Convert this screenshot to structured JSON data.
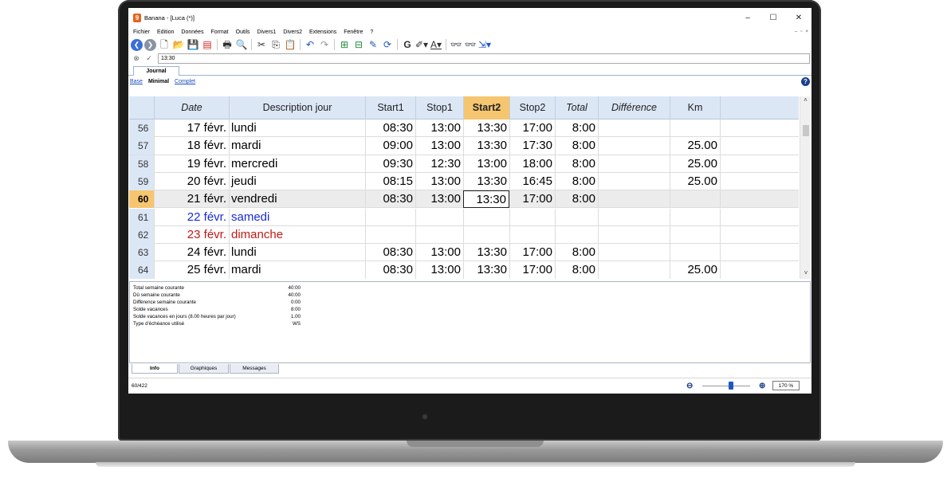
{
  "window": {
    "title": "Banana - [Luca (*)]",
    "app_icon": "9",
    "buttons": {
      "minimize": "–",
      "maximize": "☐",
      "close": "✕"
    }
  },
  "menu": [
    "Fichier",
    "Edition",
    "Données",
    "Format",
    "Outils",
    "Divers1",
    "Divers2",
    "Extensions",
    "Fenêtre",
    "?"
  ],
  "mdi_buttons": [
    "–",
    "▫",
    "×"
  ],
  "formula": {
    "value": "13:30"
  },
  "table_tab": "Journal",
  "views": {
    "base": "Base",
    "minimal": "Minimal",
    "complet": "Complet"
  },
  "columns": [
    "Date",
    "Description jour",
    "Start1",
    "Stop1",
    "Start2",
    "Stop2",
    "Total",
    "Différence",
    "Km"
  ],
  "rows": [
    {
      "n": "56",
      "date": "17 févr.",
      "desc": "lundi",
      "start1": "08:30",
      "stop1": "13:00",
      "start2": "13:30",
      "stop2": "17:00",
      "total": "8:00",
      "diff": "",
      "km": ""
    },
    {
      "n": "57",
      "date": "18 févr.",
      "desc": "mardi",
      "start1": "09:00",
      "stop1": "13:00",
      "start2": "13:30",
      "stop2": "17:30",
      "total": "8:00",
      "diff": "",
      "km": "25.00"
    },
    {
      "n": "58",
      "date": "19 févr.",
      "desc": "mercredi",
      "start1": "09:30",
      "stop1": "12:30",
      "start2": "13:00",
      "stop2": "18:00",
      "total": "8:00",
      "diff": "",
      "km": "25.00"
    },
    {
      "n": "59",
      "date": "20 févr.",
      "desc": "jeudi",
      "start1": "08:15",
      "stop1": "13:00",
      "start2": "13:30",
      "stop2": "16:45",
      "total": "8:00",
      "diff": "",
      "km": "25.00"
    },
    {
      "n": "60",
      "date": "21 févr.",
      "desc": "vendredi",
      "start1": "08:30",
      "stop1": "13:00",
      "start2": "13:30",
      "stop2": "17:00",
      "total": "8:00",
      "diff": "",
      "km": ""
    },
    {
      "n": "61",
      "date": "22 févr.",
      "desc": "samedi",
      "start1": "",
      "stop1": "",
      "start2": "",
      "stop2": "",
      "total": "",
      "diff": "",
      "km": ""
    },
    {
      "n": "62",
      "date": "23 févr.",
      "desc": "dimanche",
      "start1": "",
      "stop1": "",
      "start2": "",
      "stop2": "",
      "total": "",
      "diff": "",
      "km": ""
    },
    {
      "n": "63",
      "date": "24 févr.",
      "desc": "lundi",
      "start1": "08:30",
      "stop1": "13:00",
      "start2": "13:30",
      "stop2": "17:00",
      "total": "8:00",
      "diff": "",
      "km": ""
    },
    {
      "n": "64",
      "date": "25 févr.",
      "desc": "mardi",
      "start1": "08:30",
      "stop1": "13:00",
      "start2": "13:30",
      "stop2": "17:00",
      "total": "8:00",
      "diff": "",
      "km": "25.00"
    }
  ],
  "info": [
    {
      "label": "Total semaine courante",
      "value": "40:00"
    },
    {
      "label": "Dû semaine courante",
      "value": "40:00"
    },
    {
      "label": "Différence semaine courante",
      "value": "0:00"
    },
    {
      "label": "Solde vacances",
      "value": "8:00"
    },
    {
      "label": "Solde vacances en jours (8.00 heures par jour)",
      "value": "1.00"
    },
    {
      "label": "Type d'échéance utilisé",
      "value": "WS"
    }
  ],
  "bottom_tabs": [
    "Info",
    "Graphiques",
    "Messages"
  ],
  "status": {
    "row_count": "60/422",
    "zoom": "170 %",
    "zoom_level": 0.6
  },
  "colors": {
    "header": "#dce7f6",
    "selected_header": "#f6c56f",
    "weekend_sat": "#1a2bd6",
    "weekend_sun": "#c41a14"
  }
}
